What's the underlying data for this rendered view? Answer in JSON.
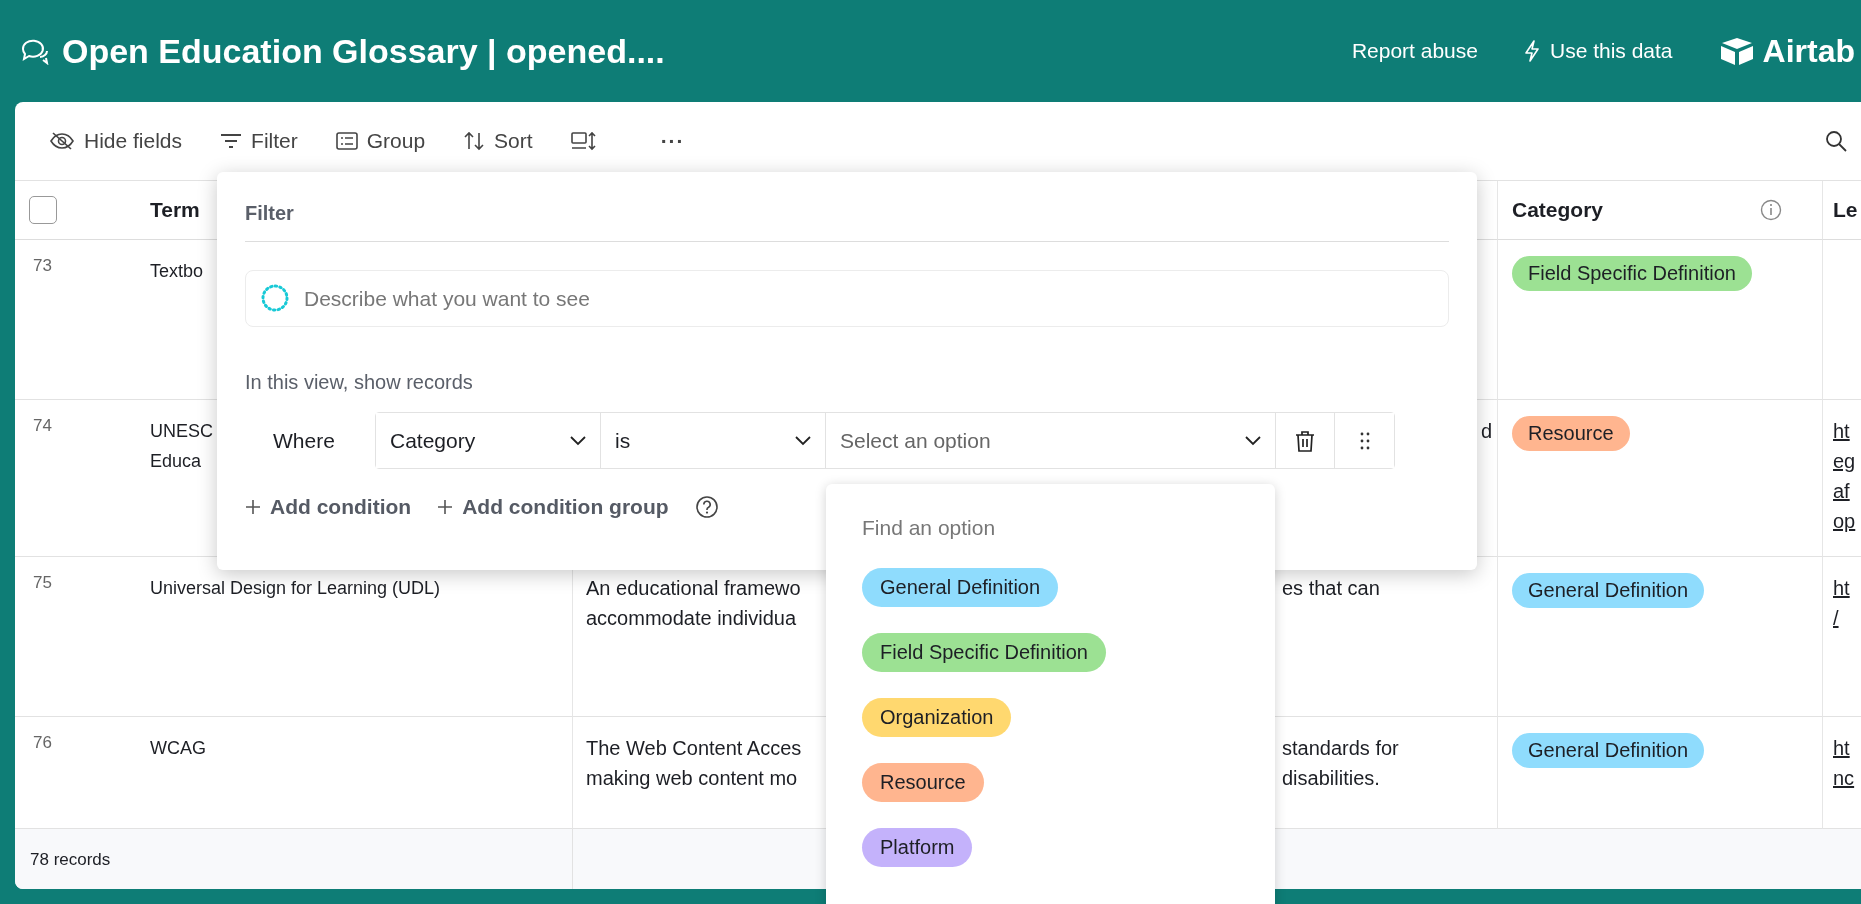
{
  "header": {
    "title": "Open Education Glossary | opened....",
    "links": [
      {
        "label": "Report abuse"
      },
      {
        "label": "Use this data"
      }
    ],
    "brand": "Airtab"
  },
  "toolbar": {
    "items": [
      {
        "label": "Hide fields"
      },
      {
        "label": "Filter"
      },
      {
        "label": "Group"
      },
      {
        "label": "Sort"
      }
    ],
    "more": "···"
  },
  "table": {
    "select_all_checked": false,
    "columns": [
      {
        "label": "Term"
      },
      {
        "label": "Category"
      },
      {
        "label": "Le"
      }
    ],
    "rows": [
      {
        "number": "73",
        "term": [
          "Textbo"
        ],
        "description_left": [],
        "description_right": [],
        "description_edge": [],
        "category": {
          "label": "Field Specific Definition",
          "color": "#9ce193"
        },
        "link": []
      },
      {
        "number": "74",
        "term": [
          "UNESC",
          "Educa"
        ],
        "description_left": [],
        "description_right": [],
        "description_edge": [
          "d"
        ],
        "category": {
          "label": "Resource",
          "color": "#ffb58f"
        },
        "link": [
          "ht",
          "eg",
          "af",
          "op"
        ]
      },
      {
        "number": "75",
        "term": [
          "Universal Design for Learning (UDL)"
        ],
        "description_left": [
          "An educational framewo",
          "accommodate individua"
        ],
        "description_right": [
          "es that can"
        ],
        "description_edge": [],
        "category": {
          "label": "General Definition",
          "color": "#8fdcfd"
        },
        "link": [
          "ht",
          "/"
        ]
      },
      {
        "number": "76",
        "term": [
          "WCAG"
        ],
        "description_left": [
          "The Web Content Acces",
          "making web content mo"
        ],
        "description_right": [
          "standards for",
          "disabilities."
        ],
        "description_edge": [],
        "category": {
          "label": "General Definition",
          "color": "#8fdcfd"
        },
        "link": [
          "ht",
          "nc"
        ]
      }
    ],
    "footer": "78 records"
  },
  "filter": {
    "title": "Filter",
    "ai_placeholder": "Describe what you want to see",
    "subtitle": "In this view, show records",
    "condition": {
      "where": "Where",
      "field": "Category",
      "operator": "is",
      "value_placeholder": "Select an option"
    },
    "add_buttons": [
      "Add condition",
      "Add condition group"
    ]
  },
  "dropdown": {
    "placeholder": "Find an option",
    "options": [
      {
        "label": "General Definition",
        "color": "#8fdcfd"
      },
      {
        "label": "Field Specific Definition",
        "color": "#9ce193"
      },
      {
        "label": "Organization",
        "color": "#ffd86f"
      },
      {
        "label": "Resource",
        "color": "#ffb58f"
      },
      {
        "label": "Platform",
        "color": "#c4b2fb"
      }
    ]
  }
}
